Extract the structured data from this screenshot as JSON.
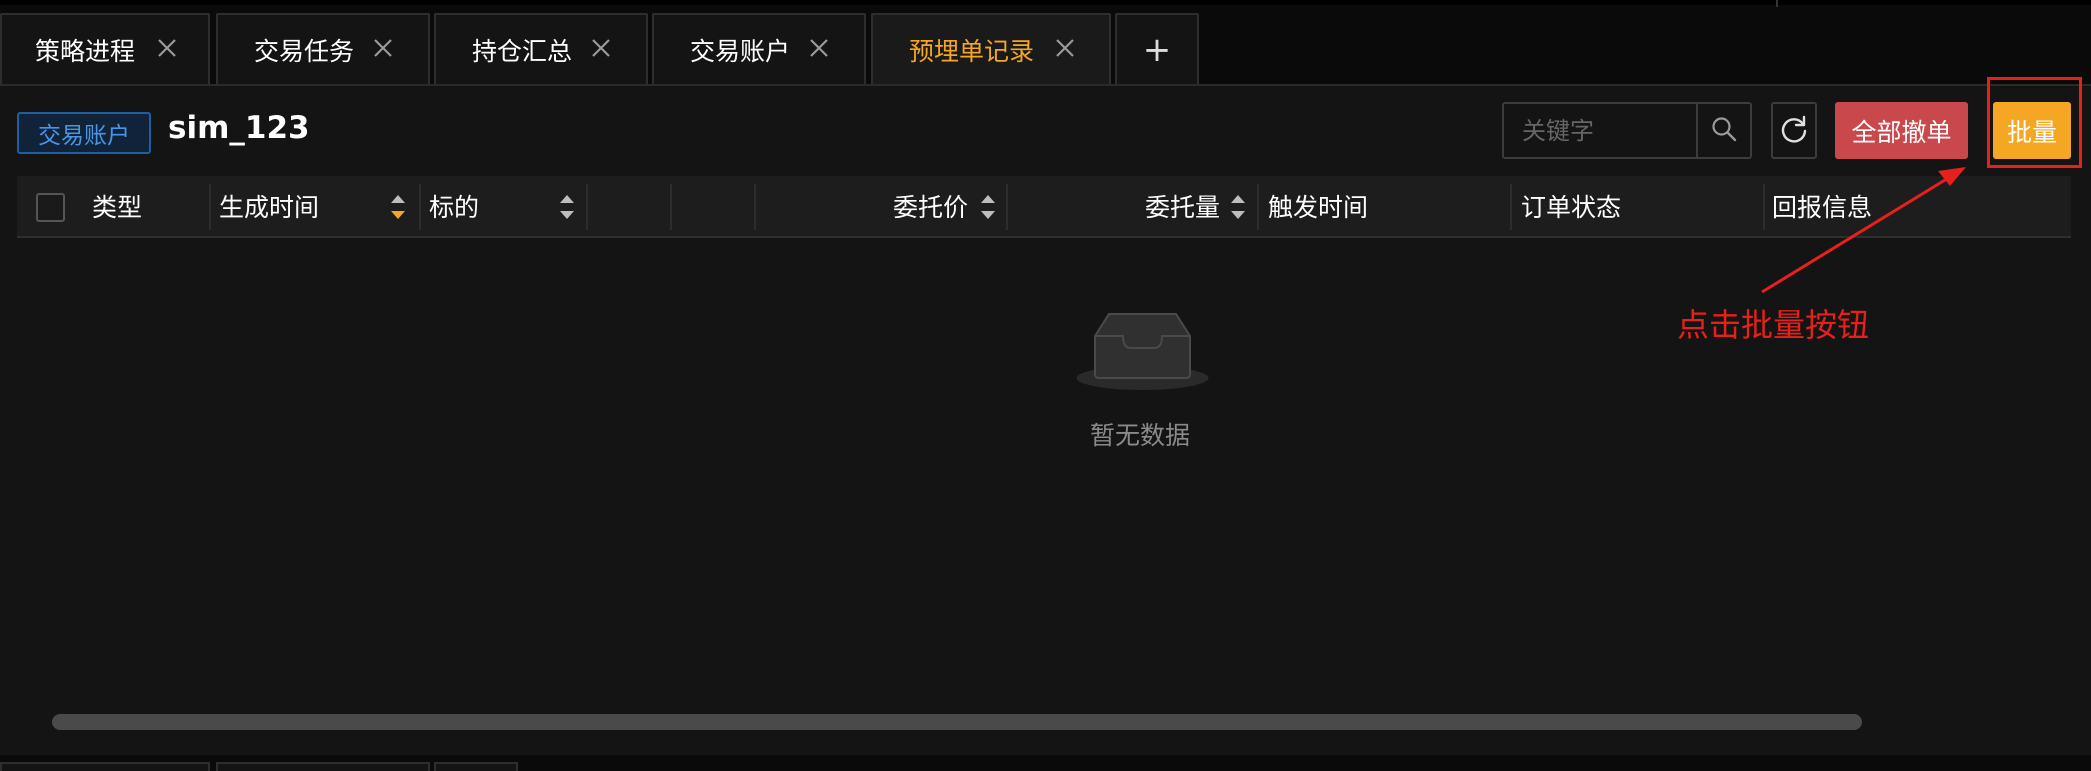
{
  "tabs": [
    {
      "label": "策略进程",
      "close_icon": "close-icon"
    },
    {
      "label": "交易任务",
      "close_icon": "close-icon"
    },
    {
      "label": "持仓汇总",
      "close_icon": "close-icon"
    },
    {
      "label": "交易账户",
      "close_icon": "close-icon"
    },
    {
      "label": "预埋单记录",
      "close_icon": "close-icon",
      "active": true
    }
  ],
  "add_tab_label": "+",
  "account": {
    "tag": "交易账户",
    "name": "sim_123"
  },
  "search": {
    "placeholder": "关键字",
    "value": "",
    "icon": "search-icon"
  },
  "toolbar": {
    "refresh_icon": "refresh-icon",
    "cancel_all_label": "全部撤单",
    "batch_label": "批量"
  },
  "table": {
    "columns": [
      "类型",
      "生成时间",
      "标的",
      "",
      "",
      "委托价",
      "委托量",
      "触发时间",
      "订单状态",
      "回报信息"
    ],
    "rows": []
  },
  "empty_state": {
    "text": "暂无数据",
    "icon": "inbox-empty-icon"
  },
  "annotation": {
    "text": "点击批量按钮",
    "color": "#e8201c"
  },
  "colors": {
    "accent": "#f5a623",
    "danger": "#c9484b",
    "link": "#4b95e6",
    "background": "#141414"
  }
}
